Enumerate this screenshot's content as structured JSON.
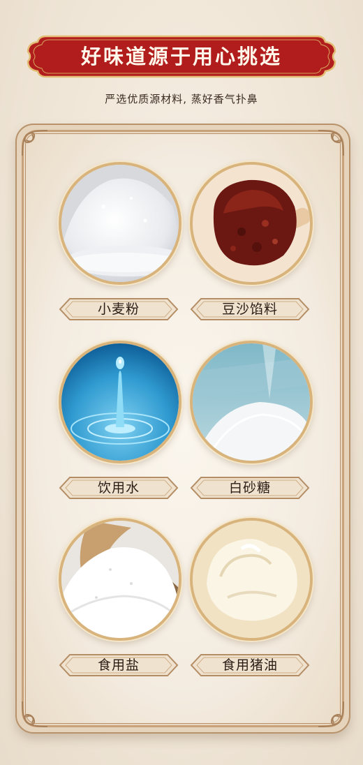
{
  "header": {
    "title": "好味道源于用心挑选",
    "subtitle": "严选优质源材料, 蒸好香气扑鼻"
  },
  "ingredients": [
    {
      "label": "小麦粉",
      "icon": "flour-image"
    },
    {
      "label": "豆沙馅料",
      "icon": "red-bean-paste-image"
    },
    {
      "label": "饮用水",
      "icon": "water-drop-image"
    },
    {
      "label": "白砂糖",
      "icon": "white-sugar-image"
    },
    {
      "label": "食用盐",
      "icon": "salt-image"
    },
    {
      "label": "食用猪油",
      "icon": "lard-image"
    }
  ],
  "colors": {
    "banner_red": "#b11c1d",
    "banner_gold": "#e2bd73",
    "frame_brown": "#b7926b",
    "background": "#f1e9dc"
  }
}
